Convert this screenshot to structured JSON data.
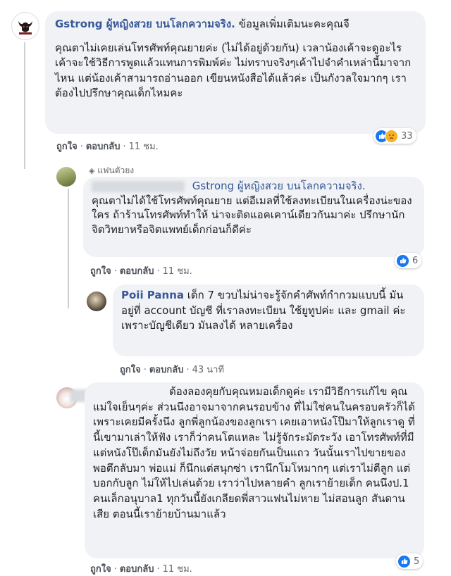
{
  "comment1": {
    "author": "Gstrong ผู้หญิงสวย บนโลกความจริง.",
    "text_intro": "ข้อมูลเพิ่มเติมนะคะคุณจี",
    "text_body": "คุณตาไม่เคยเล่นโทรศัพท์คุณยายค่ะ (ไม่ได้อยู่ด้วยกัน) เวลาน้องเค้าจะดูอะไร เค้าจะใช้วิธีการพูดแล้วแทนการพิมพ์ค่ะ ไม่ทราบจริงๆเค้าไปจำคำเหล่านี้มาจากไหน แต่น้องเค้าสามารถอ่านออก เขียนหนังสือได้แล้วค่ะ เป็นกังวลใจมากๆ เราต้องไปปรึกษาคุณเด็กไหมคะ",
    "reaction_count": "33",
    "like_label": "ถูกใจ",
    "reply_label": "ตอบกลับ",
    "time": "11 ชม."
  },
  "reply1": {
    "badge": "แฟนตัวยง",
    "mention": "Gstrong ผู้หญิงสวย บนโลกความจริง.",
    "text": "คุณตาไม่ได้ใช้โทรศัพท์คุณยาย แต่อีเมลที่ใช้ลงทะเบียนในเครื่องน่ะของใคร ถ้าร้านโทรศัพท์ทำให้ น่าจะติดแอคเคาน์เดียวกันมาค่ะ ปรึกษานักจิตวิทยาหรือจิตแพทย์เด็กก่อนก็ดีค่ะ",
    "reaction_count": "6",
    "like_label": "ถูกใจ",
    "reply_label": "ตอบกลับ",
    "time": "11 ชม."
  },
  "reply2": {
    "author": "Poii Panna",
    "text": "เด็ก 7 ขวบไม่น่าจะรู้จักคำศัพท์กำกวมแบบนี้ มันอยู่ที่ account บัญชี ที่เราลงทะเบียน ใช้ยูทูปค่ะ และ gmail ค่ะ เพราะบัญชีเดียว มันลงได้ หลายเครื่อง",
    "like_label": "ถูกใจ",
    "reply_label": "ตอบกลับ",
    "time": "43 นาที"
  },
  "comment2": {
    "text": "ต้องลองคุยกับคุณหมอเด็กดูค่ะ เรามีวิธีการแก้ไข คุณแม่ใจเย็นๆค่ะ ส่วนนึงอาจมาจากคนรอบข้าง ที่ไม่ใช่คนในครอบครัวก็ได้ เพราะเคยมีครั้งนึง ลูกพี่ลูกน้องของลูกเรา เคยเอาหนังโป๊มาให้ลูกเราดู ที่นี้เขามาเล่าให้ฟัง เราก็ว่าคนโตแหละ ไม่รู้จักระมัดระวัง เอาโทรศัพท์ที่มีแต่หนังโป๊เด็กมันยังไม่ถึงวัย หน้าจ่อยกันเป็นแถว วันนั้นเราไปขายของพอตึกลับมา พ่อแม่ ก็นึกแต่สนุกซ่า เรานึกโมโหมากๆ แต่เราไม่ตีลูก แต่บอกกับลูก ไม่ให้ไปเล่นด้วย เราว่าไปหลายคำ ลูกเราย้ายเด็ก คนนึงป.1 คนเล็กอนุบาล1 ทุกวันนี้ยังเกลียดพี่สาวแฟนไม่หาย ไม่สอนลูก สันดานเสีย ตอนนี้เราย้ายบ้านมาแล้ว",
    "reaction_count": "5",
    "like_label": "ถูกใจ",
    "reply_label": "ตอบกลับ",
    "time": "11 ชม."
  },
  "colors": {
    "link": "#385898",
    "bubble": "#f0f2f5",
    "like_blue": "#1877f2",
    "haha_yellow": "#f7b125"
  }
}
